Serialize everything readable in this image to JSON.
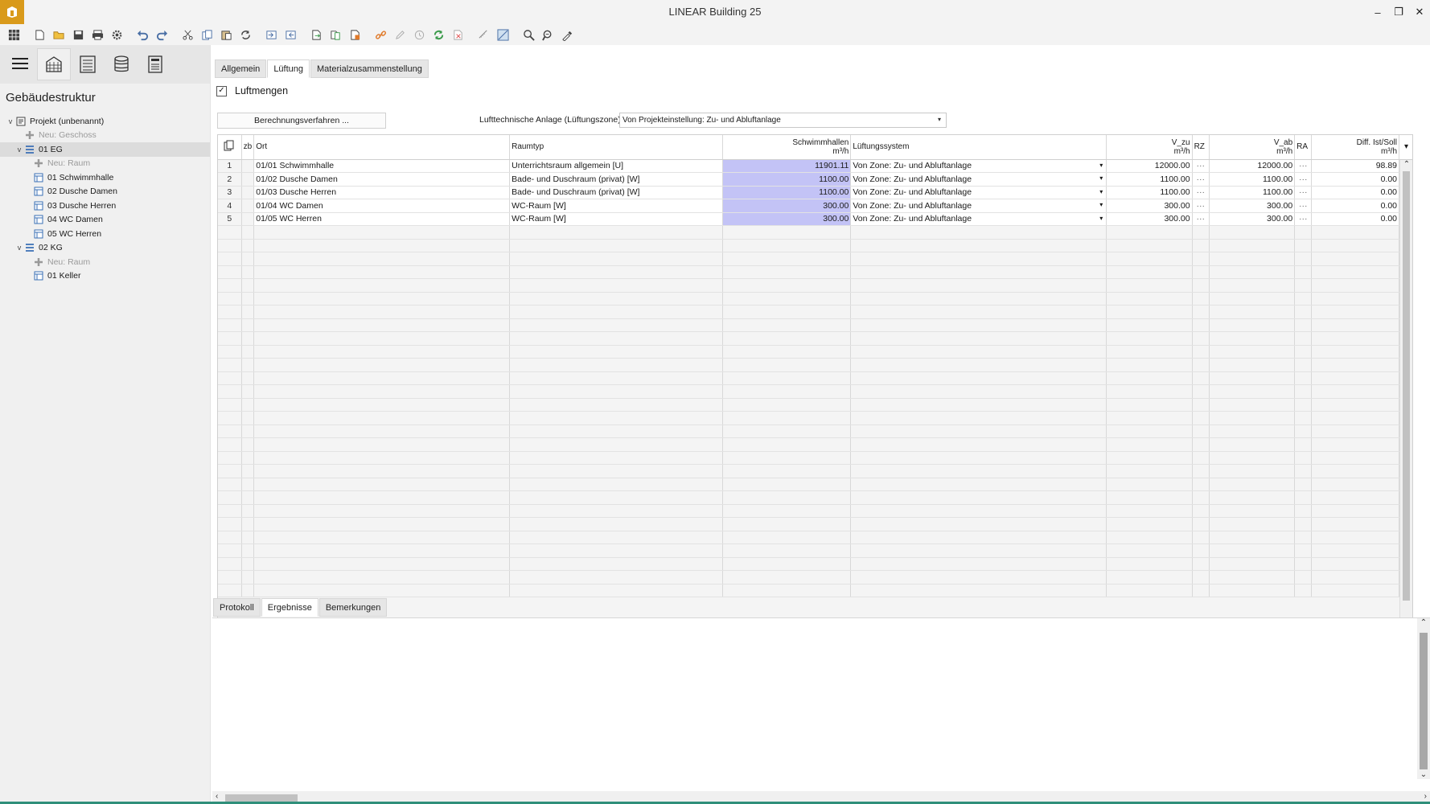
{
  "window": {
    "title": "LINEAR Building 25",
    "minimize": "–",
    "restore": "❐",
    "close": "✕"
  },
  "toolbar": {
    "icons": [
      "apps-grid-icon",
      "new-file-icon",
      "open-folder-icon",
      "save-icon",
      "print-icon",
      "settings-gear-icon",
      "undo-icon",
      "redo-icon",
      "cut-icon",
      "copy-icon",
      "paste-icon",
      "refresh-cycle-icon",
      "import-icon",
      "export-icon",
      "document-arrow-icon",
      "document-copy-icon",
      "document-calc-icon",
      "link-icon",
      "edit-pencil-icon",
      "history-icon",
      "sync-icon",
      "delete-doc-icon",
      "measure-icon",
      "diagram-icon",
      "search-icon",
      "search-extended-icon",
      "eyedropper-icon"
    ]
  },
  "sidebar": {
    "view_tabs": [
      "hamburger-menu-icon",
      "building-icon",
      "list-view-icon",
      "database-icon",
      "document-view-icon"
    ],
    "title": "Gebäudestruktur",
    "tree": [
      {
        "level": 0,
        "exp": "v",
        "icon": "project-icon",
        "label": "Projekt (unbenannt)",
        "muted": false,
        "selected": false
      },
      {
        "level": 1,
        "exp": "",
        "icon": "plus-icon",
        "label": "Neu: Geschoss",
        "muted": true,
        "selected": false
      },
      {
        "level": 1,
        "exp": "v",
        "icon": "floor-icon",
        "label": "01 EG",
        "muted": false,
        "selected": true
      },
      {
        "level": 2,
        "exp": "",
        "icon": "plus-icon",
        "label": "Neu: Raum",
        "muted": true,
        "selected": false
      },
      {
        "level": 2,
        "exp": "",
        "icon": "room-icon",
        "label": "01 Schwimmhalle",
        "muted": false,
        "selected": false
      },
      {
        "level": 2,
        "exp": "",
        "icon": "room-icon",
        "label": "02 Dusche Damen",
        "muted": false,
        "selected": false
      },
      {
        "level": 2,
        "exp": "",
        "icon": "room-icon",
        "label": "03 Dusche Herren",
        "muted": false,
        "selected": false
      },
      {
        "level": 2,
        "exp": "",
        "icon": "room-icon",
        "label": "04 WC Damen",
        "muted": false,
        "selected": false
      },
      {
        "level": 2,
        "exp": "",
        "icon": "room-icon",
        "label": "05 WC Herren",
        "muted": false,
        "selected": false
      },
      {
        "level": 1,
        "exp": "v",
        "icon": "floor-icon",
        "label": "02 KG",
        "muted": false,
        "selected": false
      },
      {
        "level": 2,
        "exp": "",
        "icon": "plus-icon",
        "label": "Neu: Raum",
        "muted": true,
        "selected": false
      },
      {
        "level": 2,
        "exp": "",
        "icon": "room-icon",
        "label": "01 Keller",
        "muted": false,
        "selected": false
      }
    ]
  },
  "main": {
    "tabs": [
      {
        "label": "Allgemein",
        "active": false
      },
      {
        "label": "Lüftung",
        "active": true
      },
      {
        "label": "Materialzusammenstellung",
        "active": false
      }
    ],
    "checkbox": {
      "label": "Luftmengen",
      "checked": "✓"
    },
    "calc_button": "Berechnungsverfahren ...",
    "zone_label": "Lufttechnische Anlage (Lüftungszone)",
    "zone_value": "Von Projekteinstellung: Zu- und Abluftanlage",
    "dropdown_arrow": "▾"
  },
  "grid": {
    "headers": {
      "zb": "zb",
      "ort": "Ort",
      "raumtyp": "Raumtyp",
      "schwimm_line1": "Schwimmhallen",
      "schwimm_unit": "m³/h",
      "system": "Lüftungssystem",
      "vzu_line1": "V_zu",
      "vzu_unit": "m³/h",
      "rz": "RZ",
      "vab_line1": "V_ab",
      "vab_unit": "m³/h",
      "ra": "RA",
      "diff_line1": "Diff. Ist/Soll",
      "diff_unit": "m³/h"
    },
    "rows": [
      {
        "idx": "1",
        "ort": "01/01 Schwimmhalle",
        "raumtyp": "Unterrichtsraum allgemein [U]",
        "schwimm": "11901.11",
        "system": "Von Zone: Zu- und Abluftanlage",
        "vzu": "12000.00",
        "rz": "···",
        "vab": "12000.00",
        "ra": "···",
        "diff": "98.89",
        "bold": true
      },
      {
        "idx": "2",
        "ort": "01/02 Dusche Damen",
        "raumtyp": "Bade- und Duschraum (privat) [W]",
        "schwimm": "1100.00",
        "system": "Von Zone: Zu- und Abluftanlage",
        "vzu": "1100.00",
        "rz": "···",
        "vab": "1100.00",
        "ra": "···",
        "diff": "0.00",
        "bold": false
      },
      {
        "idx": "3",
        "ort": "01/03 Dusche Herren",
        "raumtyp": "Bade- und Duschraum (privat) [W]",
        "schwimm": "1100.00",
        "system": "Von Zone: Zu- und Abluftanlage",
        "vzu": "1100.00",
        "rz": "···",
        "vab": "1100.00",
        "ra": "···",
        "diff": "0.00",
        "bold": false
      },
      {
        "idx": "4",
        "ort": "01/04 WC Damen",
        "raumtyp": "WC-Raum [W]",
        "schwimm": "300.00",
        "system": "Von Zone: Zu- und Abluftanlage",
        "vzu": "300.00",
        "rz": "···",
        "vab": "300.00",
        "ra": "···",
        "diff": "0.00",
        "bold": false
      },
      {
        "idx": "5",
        "ort": "01/05 WC Herren",
        "raumtyp": "WC-Raum [W]",
        "schwimm": "300.00",
        "system": "Von Zone: Zu- und Abluftanlage",
        "vzu": "300.00",
        "rz": "···",
        "vab": "300.00",
        "ra": "···",
        "diff": "0.00",
        "bold": false
      }
    ],
    "scroll_up": "⌃",
    "scroll_down": "⌄"
  },
  "bottom": {
    "tabs": [
      {
        "label": "Protokoll",
        "active": false
      },
      {
        "label": "Ergebnisse",
        "active": true
      },
      {
        "label": "Bemerkungen",
        "active": false
      }
    ],
    "scroll_left": "‹",
    "scroll_right": "›"
  },
  "colors": {
    "accent": "#d99a1b",
    "highlight": "#c3c3f6",
    "status": "#2f8f7a"
  }
}
